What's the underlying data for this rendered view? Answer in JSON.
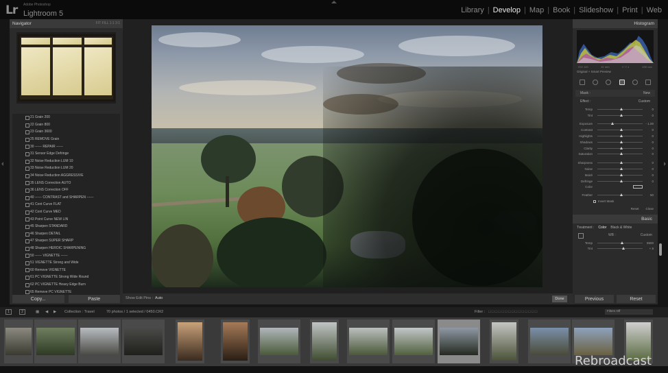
{
  "topbar": {
    "logo": "Lr",
    "product_small": "Adobe Photoshop",
    "product": "Lightroom 5",
    "modules": [
      "Library",
      "Develop",
      "Map",
      "Book",
      "Slideshow",
      "Print",
      "Web"
    ],
    "active_module": "Develop"
  },
  "left_panel": {
    "navigator_title": "Navigator",
    "zoom_options": "FIT  FILL  1:1  3:1",
    "presets": [
      "21  Grain 200",
      "22  Grain 800",
      "23  Grain 3600",
      "25  REMOVE Grain",
      "30  ------ REPAIR ------",
      "31  Sensor Edge Defringe",
      "32  Noise Reduction LUM 10",
      "33  Noise Reduction LUM 20",
      "34  Noise Reduction AGGRESSIVE",
      "35  LENS Correction AUTO",
      "36  LENS Correction OFF",
      "40  ------ CONTRAST and SHARPEN ------",
      "41  Cont Curve FLAT",
      "42  Cont Curve MED",
      "43  Point Curve NEW LIN",
      "45  Sharpen STANDARD",
      "46  Sharpen DETAIL",
      "47  Sharpen SUPER SHARP",
      "48  Sharpen HEROIC SHARPENING",
      "50  ------ VIGNETTE ------",
      "51  VIGNETTE Strong and Wide",
      "60  Remove VIGNETTE",
      "61  PC VIGNETTE Strong Wide Round",
      "62  PC VIGNETTE Heavy Edge Burn",
      "65  Remove PC VIGNETTE"
    ],
    "copy_label": "Copy...",
    "paste_label": "Paste"
  },
  "center": {
    "show_edit_pins_label": "Show Edit Pins :",
    "show_edit_pins_value": "Auto",
    "done_label": "Done"
  },
  "right_panel": {
    "histogram_title": "Histogram",
    "hist_readout": [
      "ISO 100",
      "41 mm",
      "f / 7.1",
      "1/50 sec"
    ],
    "original_photo": "Original + Smart Preview",
    "mask_label": "Mask :",
    "mask_value": "New",
    "effect_label": "Effect :",
    "effect_value": "Custom",
    "sliders": [
      {
        "label": "Temp",
        "value": "0",
        "pos": 0.5
      },
      {
        "label": "Tint",
        "value": "0",
        "pos": 0.5
      },
      {
        "label": "Exposure",
        "value": "- 1.00",
        "pos": 0.3
      },
      {
        "label": "Contrast",
        "value": "0",
        "pos": 0.5
      },
      {
        "label": "Highlights",
        "value": "0",
        "pos": 0.5
      },
      {
        "label": "Shadows",
        "value": "0",
        "pos": 0.5
      },
      {
        "label": "Clarity",
        "value": "0",
        "pos": 0.5
      },
      {
        "label": "Saturation",
        "value": "0",
        "pos": 0.5
      },
      {
        "label": "Sharpness",
        "value": "0",
        "pos": 0.5
      },
      {
        "label": "Noise",
        "value": "0",
        "pos": 0.5
      },
      {
        "label": "Moiré",
        "value": "0",
        "pos": 0.5
      },
      {
        "label": "Defringe",
        "value": "0",
        "pos": 0.5
      }
    ],
    "color_label": "Color",
    "feather_label": "Feather",
    "feather_value": "50",
    "invert_mask": "Invert Mask",
    "reset_label": "Reset",
    "close_label": "Close",
    "basic_title": "Basic",
    "treatment_label": "Treatment :",
    "treatment_color": "Color",
    "treatment_bw": "Black & White",
    "wb_label": "WB :",
    "wb_value": "Custom",
    "temp_label": "Temp",
    "temp_value": "5500",
    "tint_label": "Tint",
    "tint_value": "+ 8",
    "previous_label": "Previous",
    "reset_btn_label": "Reset"
  },
  "film_bar": {
    "page1": "1",
    "page2": "2",
    "collection": "Collection : Travel",
    "count": "70 photos / 1 selected / 0450.CR2",
    "filter_label": "Filter :",
    "filter_value": "Filters Off"
  },
  "watermark": "Rebroadcast",
  "colors": {
    "active_module": "#e8e8e8",
    "panel_bg": "#2b2b2b",
    "filmstrip_bg": "#3a3a3a"
  }
}
